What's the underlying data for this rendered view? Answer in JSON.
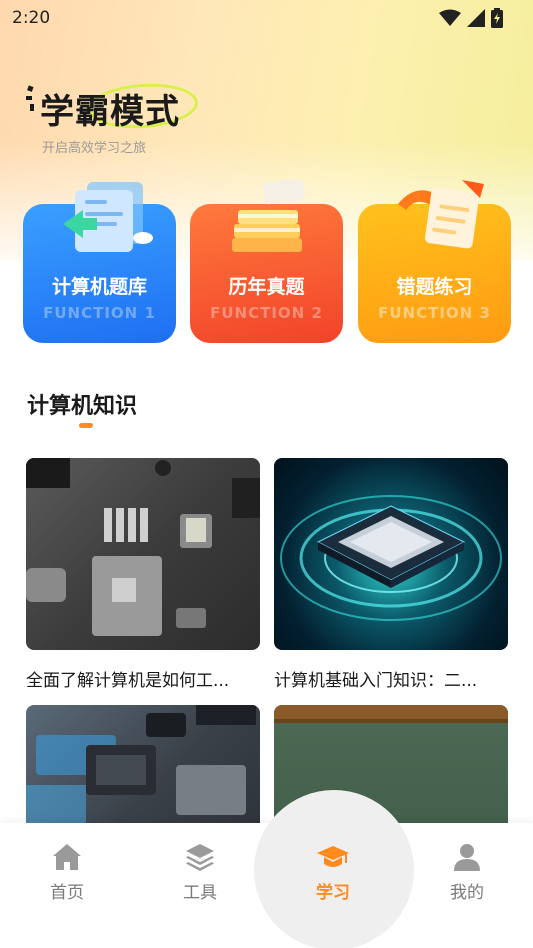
{
  "status_bar": {
    "time": "2:20"
  },
  "brand": {
    "title": "学霸模式",
    "subtitle": "开启高效学习之旅"
  },
  "function_cards": [
    {
      "title": "计算机题库",
      "subtitle": "FUNCTION 1"
    },
    {
      "title": "历年真题",
      "subtitle": "FUNCTION 2"
    },
    {
      "title": "错题练习",
      "subtitle": "FUNCTION 3"
    }
  ],
  "section": {
    "title": "计算机知识"
  },
  "articles": [
    {
      "title": "全面了解计算机是如何工..."
    },
    {
      "title": "计算机基础入门知识：二..."
    },
    {
      "title": ""
    },
    {
      "title": ""
    }
  ],
  "tabbar": {
    "tabs": [
      {
        "label": "首页",
        "icon": "home-icon"
      },
      {
        "label": "工具",
        "icon": "layers-icon"
      },
      {
        "label": "学习",
        "icon": "graduation-cap-icon"
      },
      {
        "label": "我的",
        "icon": "person-icon"
      }
    ],
    "active_index": 2
  },
  "colors": {
    "accent": "#ff8a1e",
    "card_blue": "#2b86f8",
    "card_red": "#f65a30",
    "card_yellow": "#ffae16"
  }
}
